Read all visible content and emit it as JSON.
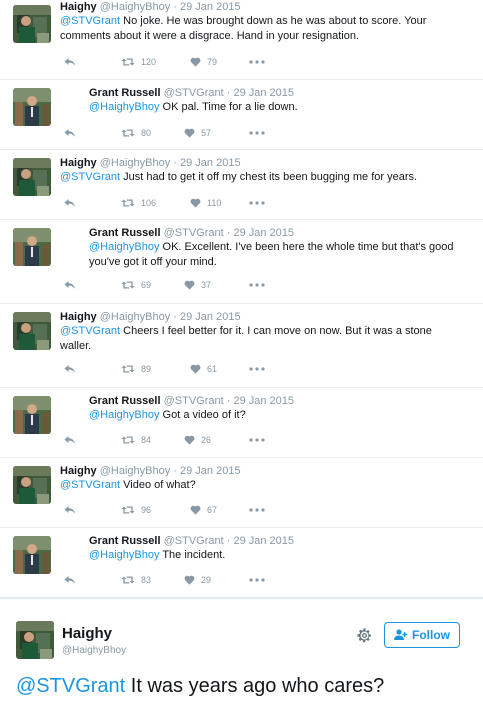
{
  "colors": {
    "link": "#1b95e0",
    "muted": "#8899a6",
    "text": "#14171a",
    "divider": "#e6ecf0"
  },
  "tweets": [
    {
      "name": "Haighy",
      "handle": "@HaighyBhoy",
      "date": "29 Jan 2015",
      "mention": "@STVGrant",
      "text": " No joke. He was brought down as he was about to score. Your comments about it were a disgrace. Hand in your resignation.",
      "retweets": "120",
      "likes": "79",
      "avatar": "haighy"
    },
    {
      "name": "Grant Russell",
      "handle": "@STVGrant",
      "date": "29 Jan 2015",
      "mention": "@HaighyBhoy",
      "text": " OK pal. Time for a lie down.",
      "retweets": "80",
      "likes": "57",
      "avatar": "grant"
    },
    {
      "name": "Haighy",
      "handle": "@HaighyBhoy",
      "date": "29 Jan 2015",
      "mention": "@STVGrant",
      "text": " Just had to get it off my chest its been bugging me for years.",
      "retweets": "106",
      "likes": "110",
      "avatar": "haighy"
    },
    {
      "name": "Grant Russell",
      "handle": "@STVGrant",
      "date": "29 Jan 2015",
      "mention": "@HaighyBhoy",
      "text": " OK. Excellent. I've been here the whole time but that's good you've got it off your mind.",
      "retweets": "69",
      "likes": "37",
      "avatar": "grant"
    },
    {
      "name": "Haighy",
      "handle": "@HaighyBhoy",
      "date": "29 Jan 2015",
      "mention": "@STVGrant",
      "text": " Cheers I feel better for it. I can move on now. But it was a stone waller.",
      "retweets": "89",
      "likes": "61",
      "avatar": "haighy"
    },
    {
      "name": "Grant Russell",
      "handle": "@STVGrant",
      "date": "29 Jan 2015",
      "mention": "@HaighyBhoy",
      "text": " Got a video of it?",
      "retweets": "84",
      "likes": "26",
      "avatar": "grant"
    },
    {
      "name": "Haighy",
      "handle": "@HaighyBhoy",
      "date": "29 Jan 2015",
      "mention": "@STVGrant",
      "text": " Video of what?",
      "retweets": "96",
      "likes": "67",
      "avatar": "haighy"
    },
    {
      "name": "Grant Russell",
      "handle": "@STVGrant",
      "date": "29 Jan 2015",
      "mention": "@HaighyBhoy",
      "text": " The incident.",
      "retweets": "83",
      "likes": "29",
      "avatar": "grant"
    }
  ],
  "main_tweet": {
    "name": "Haighy",
    "handle": "@HaighyBhoy",
    "follow_label": "Follow",
    "mention": "@STVGrant",
    "text": " It was years ago who cares?"
  }
}
